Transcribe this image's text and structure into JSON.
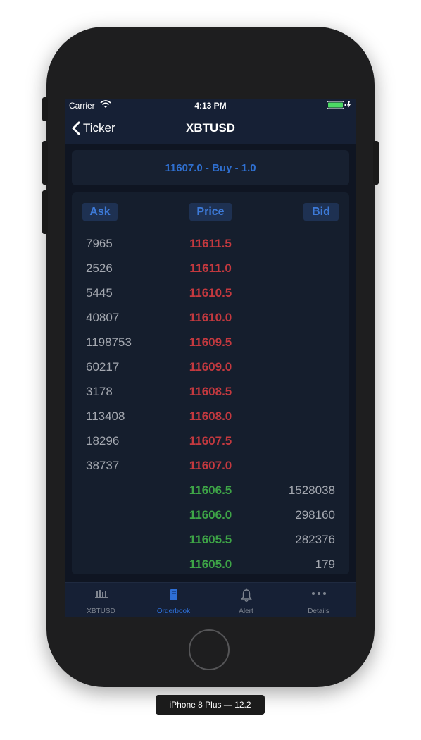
{
  "status_bar": {
    "carrier": "Carrier",
    "time": "4:13 PM"
  },
  "nav": {
    "back_label": "Ticker",
    "title": "XBTUSD"
  },
  "last_trade": "11607.0 - Buy - 1.0",
  "orderbook": {
    "headers": {
      "ask": "Ask",
      "price": "Price",
      "bid": "Bid"
    },
    "rows": [
      {
        "ask": "7965",
        "price": "11611.5",
        "bid": "",
        "side": "ask"
      },
      {
        "ask": "2526",
        "price": "11611.0",
        "bid": "",
        "side": "ask"
      },
      {
        "ask": "5445",
        "price": "11610.5",
        "bid": "",
        "side": "ask"
      },
      {
        "ask": "40807",
        "price": "11610.0",
        "bid": "",
        "side": "ask"
      },
      {
        "ask": "1198753",
        "price": "11609.5",
        "bid": "",
        "side": "ask"
      },
      {
        "ask": "60217",
        "price": "11609.0",
        "bid": "",
        "side": "ask"
      },
      {
        "ask": "3178",
        "price": "11608.5",
        "bid": "",
        "side": "ask"
      },
      {
        "ask": "113408",
        "price": "11608.0",
        "bid": "",
        "side": "ask"
      },
      {
        "ask": "18296",
        "price": "11607.5",
        "bid": "",
        "side": "ask"
      },
      {
        "ask": "38737",
        "price": "11607.0",
        "bid": "",
        "side": "ask"
      },
      {
        "ask": "",
        "price": "11606.5",
        "bid": "1528038",
        "side": "bid"
      },
      {
        "ask": "",
        "price": "11606.0",
        "bid": "298160",
        "side": "bid"
      },
      {
        "ask": "",
        "price": "11605.5",
        "bid": "282376",
        "side": "bid"
      },
      {
        "ask": "",
        "price": "11605.0",
        "bid": "179",
        "side": "bid"
      }
    ]
  },
  "tabs": [
    {
      "label": "XBTUSD",
      "icon": "bar-chart-icon",
      "active": false
    },
    {
      "label": "Orderbook",
      "icon": "book-icon",
      "active": true
    },
    {
      "label": "Alert",
      "icon": "bell-icon",
      "active": false
    },
    {
      "label": "Details",
      "icon": "more-icon",
      "active": false
    }
  ],
  "device_label": "iPhone 8 Plus — 12.2",
  "colors": {
    "ask_price": "#c4393f",
    "bid_price": "#3ea547",
    "accent": "#2e6fd6",
    "background": "#0f1522",
    "bar": "#162035"
  }
}
